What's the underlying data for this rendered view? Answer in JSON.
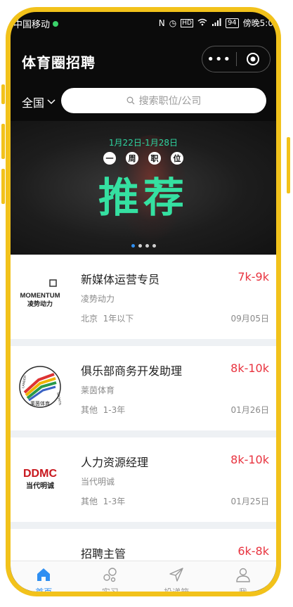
{
  "status_bar": {
    "carrier": "中国移动",
    "icons": [
      "nfc-icon",
      "alarm-icon",
      "hd-icon",
      "wifi-icon",
      "signal-icon"
    ],
    "battery": "94",
    "time": "傍晚5:0"
  },
  "header": {
    "title": "体育圈招聘",
    "more_icon": "•••",
    "target_icon": "record-target-icon"
  },
  "search": {
    "region": "全国",
    "placeholder": "搜索职位/公司"
  },
  "banner": {
    "date_range": "1月22日-1月28日",
    "chips": [
      "一",
      "周",
      "职",
      "位"
    ],
    "headline": "推荐",
    "slide_count": 4,
    "active_slide": 1
  },
  "jobs": [
    {
      "title": "新媒体运营专员",
      "company": "凌势动力",
      "location": "北京",
      "experience": "1年以下",
      "salary": "7k-9k",
      "date": "09月05日",
      "logo_text": [
        "MOMENTUM",
        "凌势动力"
      ]
    },
    {
      "title": "俱乐部商务开发助理",
      "company": "莱茵体育",
      "location": "其他",
      "experience": "1-3年",
      "salary": "8k-10k",
      "date": "01月26日",
      "logo_text": [
        "LANDER",
        "莱茵体育",
        "SPORTS"
      ]
    },
    {
      "title": "人力资源经理",
      "company": "当代明诚",
      "location": "其他",
      "experience": "1-3年",
      "salary": "8k-10k",
      "date": "01月25日",
      "logo_text": [
        "DDMC",
        "当代明诚"
      ]
    },
    {
      "title": "招聘主管",
      "salary": "6k-8k"
    }
  ],
  "tabs": [
    {
      "label": "首页",
      "icon": "home-icon",
      "active": true
    },
    {
      "label": "实习",
      "icon": "bubbles-icon",
      "active": false
    },
    {
      "label": "投递箱",
      "icon": "paper-plane-icon",
      "active": false
    },
    {
      "label": "我",
      "icon": "user-icon",
      "active": false
    }
  ],
  "colors": {
    "accent": "#2f8ff2",
    "salary": "#e8333f",
    "banner_green": "#35e0a1",
    "frame": "#f2c21b"
  }
}
